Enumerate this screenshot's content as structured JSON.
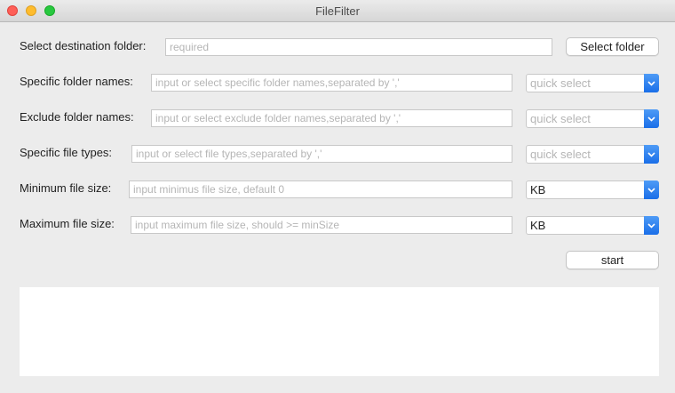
{
  "window": {
    "title": "FileFilter"
  },
  "destination": {
    "label": "Select destination folder:",
    "placeholder": "required",
    "button_label": "Select folder"
  },
  "specific_folders": {
    "label": "Specific folder names:",
    "placeholder": "input or select specific folder names,separated by ','",
    "select_value": "quick select"
  },
  "exclude_folders": {
    "label": "Exclude folder names:",
    "placeholder": "input or select exclude folder names,separated by ','",
    "select_value": "quick select"
  },
  "file_types": {
    "label": "Specific file types:",
    "placeholder": "input or select file types,separated by ','",
    "select_value": "quick select"
  },
  "min_size": {
    "label": "Minimum file size:",
    "placeholder": "input minimus file size, default 0",
    "unit": "KB"
  },
  "max_size": {
    "label": "Maximum file size:",
    "placeholder": "input maximum file size, should >= minSize",
    "unit": "KB"
  },
  "start": {
    "label": "start"
  },
  "colors": {
    "accent": "#1a6fe8",
    "close": "#fe5f57",
    "minimize": "#febc2e",
    "maximize": "#28c840"
  }
}
